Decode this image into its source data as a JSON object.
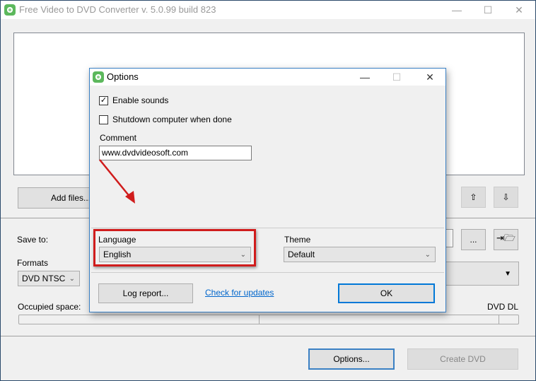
{
  "window": {
    "title": "Free Video to DVD Converter  v. 5.0.99 build 823",
    "minimize": "—",
    "maximize": "☐",
    "close": "✕"
  },
  "main": {
    "add_files": "Add files...",
    "up_icon": "⇧",
    "down_icon": "⇩",
    "save_to_label": "Save to:",
    "browse_label": "...",
    "open_folder_icon": "⇥🗁",
    "formats_label": "Formats",
    "format_value": "DVD NTSC",
    "occupied_label": "Occupied space:",
    "dvd_dl_label": "DVD DL",
    "options_button": "Options...",
    "create_dvd_button": "Create DVD"
  },
  "dialog": {
    "title": "Options",
    "enable_sounds": {
      "label": "Enable sounds",
      "checked": true
    },
    "shutdown": {
      "label": "Shutdown computer when done",
      "checked": false
    },
    "comment_label": "Comment",
    "comment_value": "www.dvdvideosoft.com",
    "language_label": "Language",
    "language_value": "English",
    "theme_label": "Theme",
    "theme_value": "Default",
    "log_report": "Log report...",
    "check_updates": "Check for updates",
    "ok": "OK",
    "check_mark": "✓"
  },
  "colors": {
    "highlight": "#d01c1c",
    "accent": "#3a80c4",
    "logo": "#5cb85c"
  }
}
